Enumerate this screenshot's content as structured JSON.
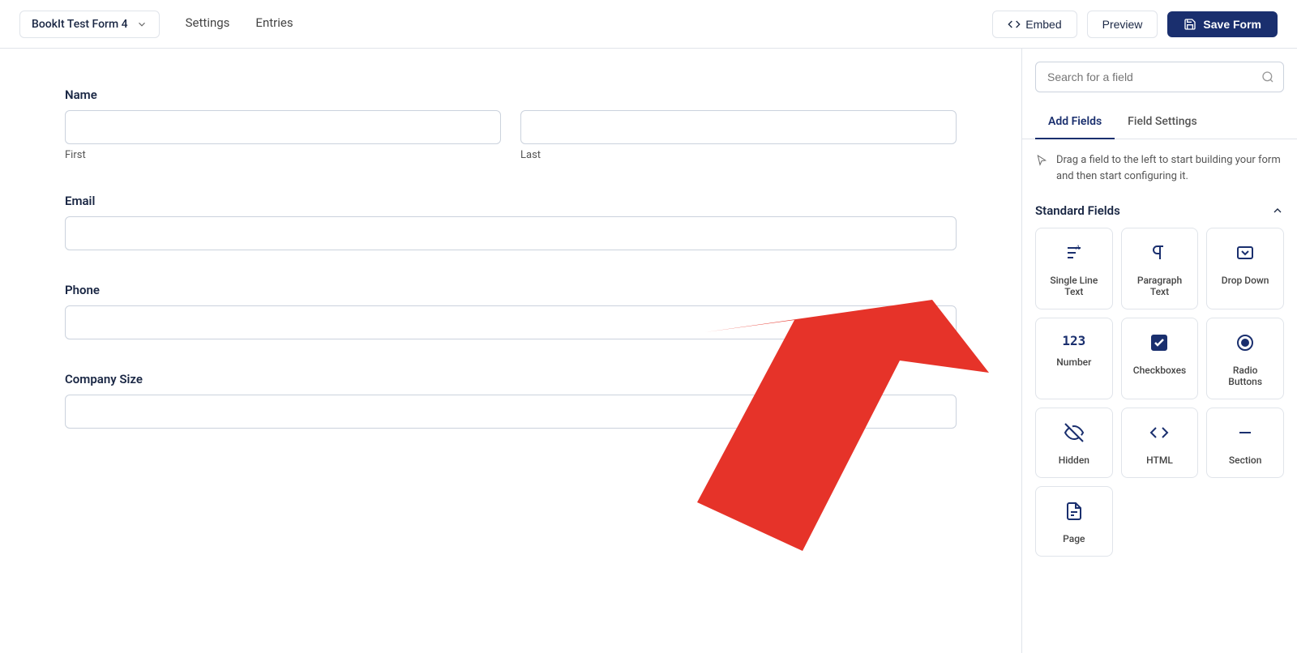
{
  "header": {
    "form_name": "BookIt Test Form 4",
    "nav": [
      "Settings",
      "Entries"
    ],
    "embed_label": "Embed",
    "preview_label": "Preview",
    "save_label": "Save Form"
  },
  "form": {
    "fields": [
      {
        "id": "name",
        "label": "Name",
        "type": "split",
        "sub_fields": [
          {
            "id": "first",
            "placeholder": "",
            "sub_label": "First"
          },
          {
            "id": "last",
            "placeholder": "",
            "sub_label": "Last"
          }
        ]
      },
      {
        "id": "email",
        "label": "Email",
        "type": "single",
        "placeholder": ""
      },
      {
        "id": "phone",
        "label": "Phone",
        "type": "single",
        "placeholder": ""
      },
      {
        "id": "company_size",
        "label": "Company Size",
        "type": "single",
        "placeholder": ""
      }
    ]
  },
  "sidebar": {
    "search_placeholder": "Search for a field",
    "tabs": [
      {
        "id": "add-fields",
        "label": "Add Fields",
        "active": true
      },
      {
        "id": "field-settings",
        "label": "Field Settings",
        "active": false
      }
    ],
    "drag_hint": "Drag a field to the left to start building your form and then start configuring it.",
    "standard_fields_label": "Standard Fields",
    "fields": [
      {
        "id": "single-line-text",
        "label": "Single Line Text",
        "icon": "A"
      },
      {
        "id": "paragraph-text",
        "label": "Paragraph Text",
        "icon": "¶"
      },
      {
        "id": "drop-down",
        "label": "Drop Down",
        "icon": "dropdown"
      },
      {
        "id": "number",
        "label": "Number",
        "icon": "123"
      },
      {
        "id": "checkboxes",
        "label": "Checkboxes",
        "icon": "check"
      },
      {
        "id": "radio-buttons",
        "label": "Radio Buttons",
        "icon": "radio"
      },
      {
        "id": "hidden",
        "label": "Hidden",
        "icon": "hidden"
      },
      {
        "id": "html",
        "label": "HTML",
        "icon": "<>"
      },
      {
        "id": "section",
        "label": "Section",
        "icon": "dash"
      },
      {
        "id": "page",
        "label": "Page",
        "icon": "page"
      }
    ]
  },
  "colors": {
    "primary": "#1a2f6e",
    "border": "#cbd2dd",
    "arrow_red": "#e63329"
  }
}
